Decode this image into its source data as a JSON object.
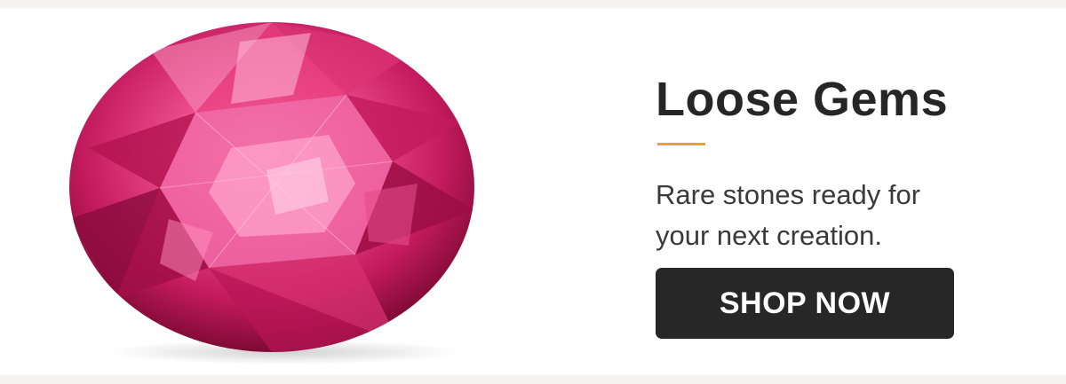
{
  "banner": {
    "title": "Loose Gems",
    "subtitle_line1": "Rare stones ready for",
    "subtitle_line2": "your next creation.",
    "cta_label": "SHOP NOW",
    "accent_color": "#e0a43a",
    "gem_color": "#d62d73",
    "button_color": "#272727"
  }
}
